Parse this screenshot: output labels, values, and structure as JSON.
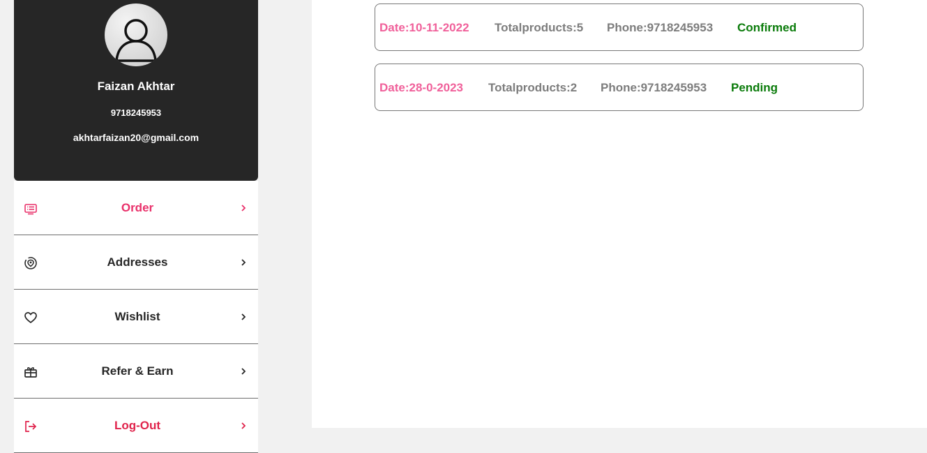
{
  "profile": {
    "name": "Faizan Akhtar",
    "phone": "9718245953",
    "email": "akhtarfaizan20@gmail.com",
    "avatar_icon": "user-icon"
  },
  "menu": {
    "items": [
      {
        "label": "Order",
        "icon": "order-list-icon",
        "active": true
      },
      {
        "label": "Addresses",
        "icon": "location-pin-icon"
      },
      {
        "label": "Wishlist",
        "icon": "heart-icon"
      },
      {
        "label": "Refer & Earn",
        "icon": "gift-icon"
      },
      {
        "label": "Log-Out",
        "icon": "logout-icon"
      }
    ]
  },
  "orders": [
    {
      "date": "Date:10-11-2022",
      "products": "Totalproducts:5",
      "phone": "Phone:9718245953",
      "status": "Confirmed"
    },
    {
      "date": "Date:28-0-2023",
      "products": "Totalproducts:2",
      "phone": "Phone:9718245953",
      "status": "Pending"
    }
  ],
  "colors": {
    "accent": "#e9306a",
    "date": "#f0609a",
    "status_green": "#0a7b0a",
    "profile_bg": "#262626",
    "logout": "#e0224b"
  }
}
